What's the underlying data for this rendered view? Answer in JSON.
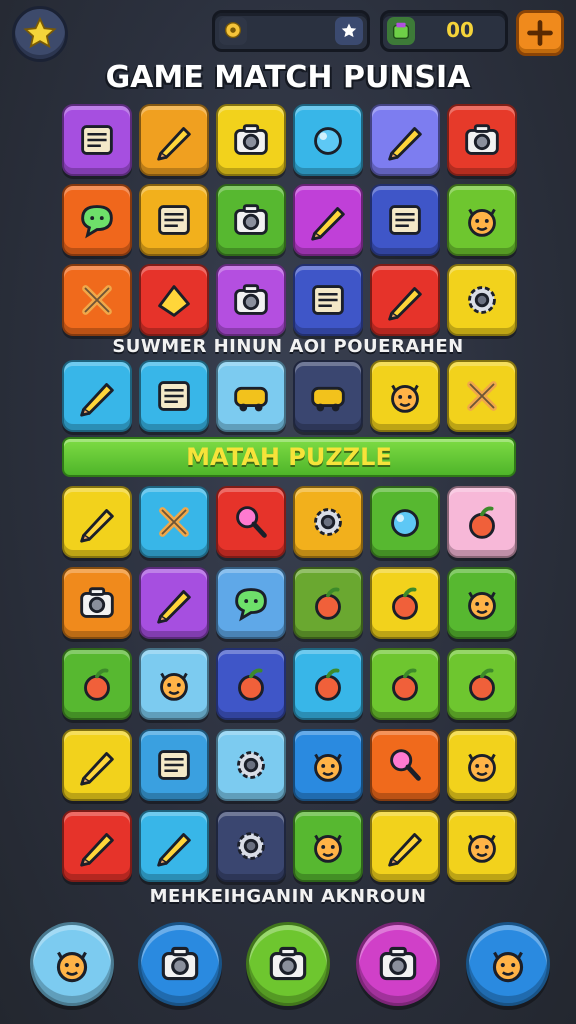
{
  "header": {
    "title": "GAME MATCH PUNSIA",
    "coins_value": "00",
    "star_button_icon": "star-icon",
    "plus_button_icon": "plus-icon"
  },
  "section_captions": {
    "middle": "SUWMER HINUN AOI POUERAHEN",
    "bottom": "MEHKEIHGANIN AKNROUN"
  },
  "banner": {
    "label": "MATAH PUZZLE"
  },
  "board_rows": [
    [
      {
        "icon": "notepad-icon",
        "color": "#a64fe0"
      },
      {
        "icon": "rocket-icon",
        "color": "#f0a020"
      },
      {
        "icon": "briefcase-icon",
        "color": "#f2d21c"
      },
      {
        "icon": "ball-icon",
        "color": "#38b6e8"
      },
      {
        "icon": "pencil-icon",
        "color": "#7d7df0"
      },
      {
        "icon": "camera-icon",
        "color": "#e63a2a"
      }
    ],
    [
      {
        "icon": "chat-bubble-icon",
        "color": "#f0671c"
      },
      {
        "icon": "device-icon",
        "color": "#f2b01c"
      },
      {
        "icon": "robot-icon",
        "color": "#57b830"
      },
      {
        "icon": "leaf-icon",
        "color": "#c040d8"
      },
      {
        "icon": "phone-icon",
        "color": "#3f56c8"
      },
      {
        "icon": "face-icon",
        "color": "#6ec62f"
      }
    ],
    [
      {
        "icon": "bone-icon",
        "color": "#f06a1c"
      },
      {
        "icon": "paper-icon",
        "color": "#e6332a"
      },
      {
        "icon": "bag-icon",
        "color": "#b44fe0"
      },
      {
        "icon": "window-icon",
        "color": "#3f56c8"
      },
      {
        "icon": "pepper-icon",
        "color": "#e6332a"
      },
      {
        "icon": "propeller-icon",
        "color": "#f2d21c"
      }
    ],
    [
      {
        "icon": "feather-icon",
        "color": "#38b6e8"
      },
      {
        "icon": "frame-icon",
        "color": "#38b6e8"
      },
      {
        "icon": "dice-icon",
        "color": "#7ccbf0"
      },
      {
        "icon": "car-icon",
        "color": "#3a4670"
      },
      {
        "icon": "sun-icon",
        "color": "#f2d21c"
      },
      {
        "icon": "ban-icon",
        "color": "#f2d21c"
      }
    ],
    [
      {
        "icon": "crossed-pencils-icon",
        "color": "#f2d21c"
      },
      {
        "icon": "crossed-swords-icon",
        "color": "#38b6e8"
      },
      {
        "icon": "magnifier-icon",
        "color": "#e6332a"
      },
      {
        "icon": "gear-flower-icon",
        "color": "#f2b01c"
      },
      {
        "icon": "bird-icon",
        "color": "#57b830"
      },
      {
        "icon": "melon-icon",
        "color": "#f7b8d8"
      }
    ],
    [
      {
        "icon": "drum-icon",
        "color": "#f08a1c"
      },
      {
        "icon": "feather-icon",
        "color": "#a64fe0"
      },
      {
        "icon": "speech-icon",
        "color": "#5fa8e8"
      },
      {
        "icon": "pizza-icon",
        "color": "#6aa830"
      },
      {
        "icon": "palm-star-icon",
        "color": "#f2d21c"
      },
      {
        "icon": "cat-icon",
        "color": "#57b830"
      }
    ],
    [
      {
        "icon": "fruit-icon",
        "color": "#57b830"
      },
      {
        "icon": "sun-face-icon",
        "color": "#7ccbf0"
      },
      {
        "icon": "apple-icon",
        "color": "#3f56c8"
      },
      {
        "icon": "orange-icon",
        "color": "#38b6e8"
      },
      {
        "icon": "spiky-fruit-icon",
        "color": "#6ec62f"
      },
      {
        "icon": "palm-tree-icon",
        "color": "#6ec62f"
      }
    ],
    [
      {
        "icon": "plane-icon",
        "color": "#f2d21c"
      },
      {
        "icon": "browser-icon",
        "color": "#3aa0e0"
      },
      {
        "icon": "cog-icon",
        "color": "#7ccbf0"
      },
      {
        "icon": "bear-icon",
        "color": "#2a8ae0"
      },
      {
        "icon": "lollipop-icon",
        "color": "#f06a1c"
      },
      {
        "icon": "cloud-face-icon",
        "color": "#f2d21c"
      }
    ],
    [
      {
        "icon": "bow-icon",
        "color": "#e6332a"
      },
      {
        "icon": "paper-plane-icon",
        "color": "#38b6e8"
      },
      {
        "icon": "spiral-icon",
        "color": "#3a4670"
      },
      {
        "icon": "bear-face-icon",
        "color": "#57b830"
      },
      {
        "icon": "crayon-icon",
        "color": "#f2d21c"
      },
      {
        "icon": "cat-face-icon",
        "color": "#f2d21c"
      }
    ]
  ],
  "dock": [
    {
      "icon": "chat-face-icon",
      "color": "#7ccbf0"
    },
    {
      "icon": "suitcase-icon",
      "color": "#2a8ae0"
    },
    {
      "icon": "photo-camera-icon",
      "color": "#6ec62f"
    },
    {
      "icon": "travel-bag-icon",
      "color": "#d040c8"
    },
    {
      "icon": "fox-face-icon",
      "color": "#2a8ae0"
    }
  ]
}
